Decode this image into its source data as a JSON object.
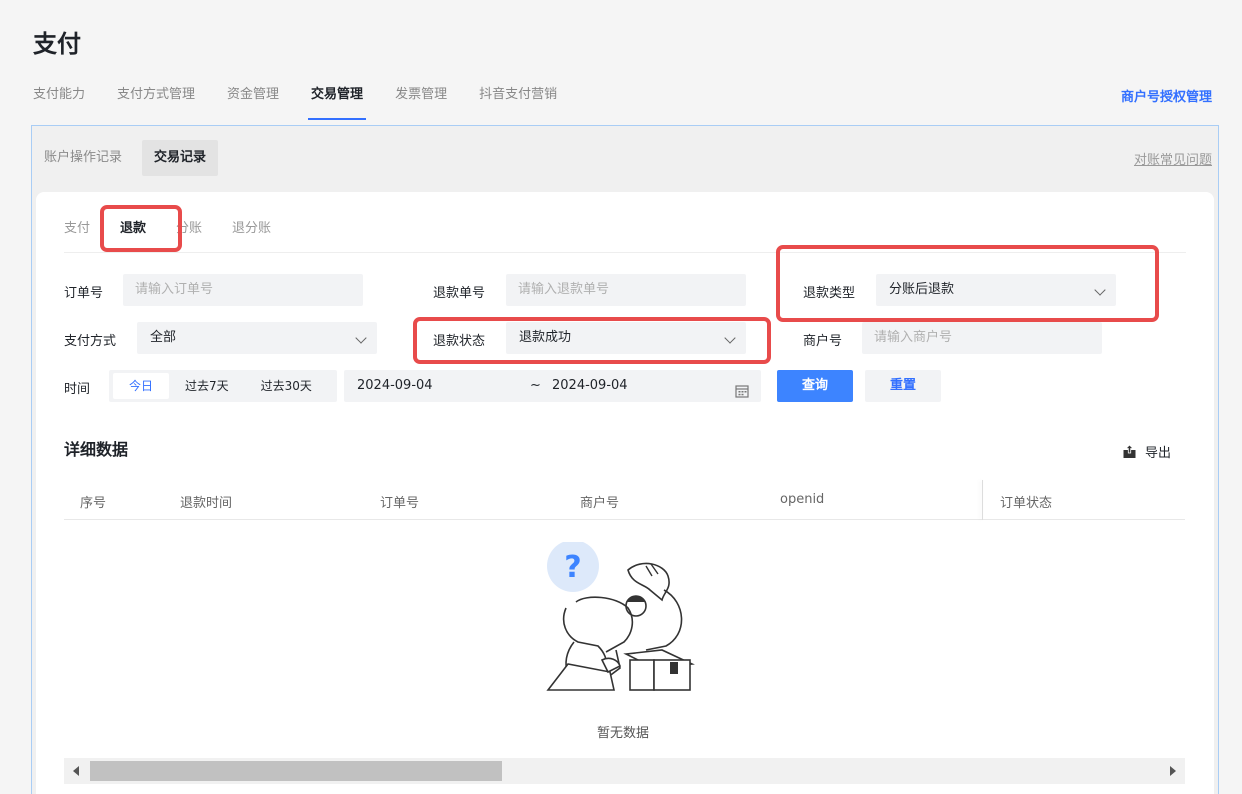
{
  "page": {
    "title": "支付"
  },
  "top_tabs": [
    {
      "label": "支付能力"
    },
    {
      "label": "支付方式管理"
    },
    {
      "label": "资金管理"
    },
    {
      "label": "交易管理",
      "active": true
    },
    {
      "label": "发票管理"
    },
    {
      "label": "抖音支付营销"
    }
  ],
  "top_right_link": "商户号授权管理",
  "sub_tabs": [
    {
      "label": "账户操作记录"
    },
    {
      "label": "交易记录",
      "active": true
    }
  ],
  "faq_link": "对账常见问题",
  "type_tabs": [
    {
      "label": "支付"
    },
    {
      "label": "退款",
      "active": true
    },
    {
      "label": "分账"
    },
    {
      "label": "退分账"
    }
  ],
  "filters": {
    "order_no": {
      "label": "订单号",
      "placeholder": "请输入订单号"
    },
    "refund_no": {
      "label": "退款单号",
      "placeholder": "请输入退款单号"
    },
    "refund_type": {
      "label": "退款类型",
      "value": "分账后退款"
    },
    "pay_method": {
      "label": "支付方式",
      "value": "全部"
    },
    "refund_status": {
      "label": "退款状态",
      "value": "退款成功"
    },
    "merchant_no": {
      "label": "商户号",
      "placeholder": "请输入商户号"
    },
    "time": {
      "label": "时间",
      "options": [
        "今日",
        "过去7天",
        "过去30天"
      ],
      "active_option": "今日",
      "start_date": "2024-09-04",
      "separator": "~",
      "end_date": "2024-09-04"
    }
  },
  "buttons": {
    "query": "查询",
    "reset": "重置"
  },
  "details": {
    "title": "详细数据",
    "export_label": "导出",
    "columns": [
      "序号",
      "退款时间",
      "订单号",
      "商户号",
      "openid",
      "订单状态"
    ],
    "empty_text": "暂无数据"
  },
  "colors": {
    "accent": "#3370ff",
    "highlight": "#e84b4b"
  },
  "icons": {
    "export": "export-icon",
    "calendar": "calendar-icon",
    "empty": "empty-state-illustration"
  }
}
